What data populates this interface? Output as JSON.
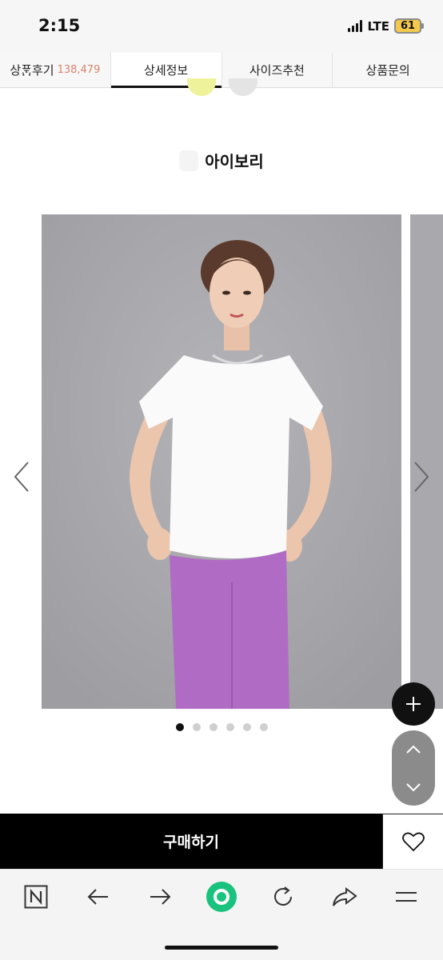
{
  "status_bar": {
    "time": "2:15",
    "network": "LTE",
    "battery": "61"
  },
  "tabs": [
    {
      "label": "상품후기",
      "count": "138,479"
    },
    {
      "label": "상세정보",
      "count": ""
    },
    {
      "label": "사이즈추천",
      "count": ""
    },
    {
      "label": "상품문의",
      "count": ""
    }
  ],
  "active_tab": "상세정보",
  "product": {
    "color_name": "아이보리"
  },
  "carousel": {
    "slide_count": 6,
    "active_index": 0
  },
  "purchase": {
    "buy_label": "구매하기"
  },
  "colors": {
    "accent": "#000000",
    "review_count": "#d9826b",
    "background_photo": "#aaaaae",
    "top_shirt": "#ffffff",
    "leggings": "#b06cc4",
    "swatch_yellow": "#eef29a"
  },
  "icons": {
    "close": "close-icon",
    "prev": "chevron-left-icon",
    "next": "chevron-right-icon",
    "plus": "plus-icon",
    "scroll_up": "chevron-up-icon",
    "scroll_down": "chevron-down-icon",
    "wish": "heart-icon",
    "naver": "n-logo-icon",
    "back": "arrow-left-icon",
    "forward": "arrow-right-icon",
    "home": "green-circle-icon",
    "reload": "reload-icon",
    "share": "share-icon",
    "menu": "menu-icon"
  }
}
